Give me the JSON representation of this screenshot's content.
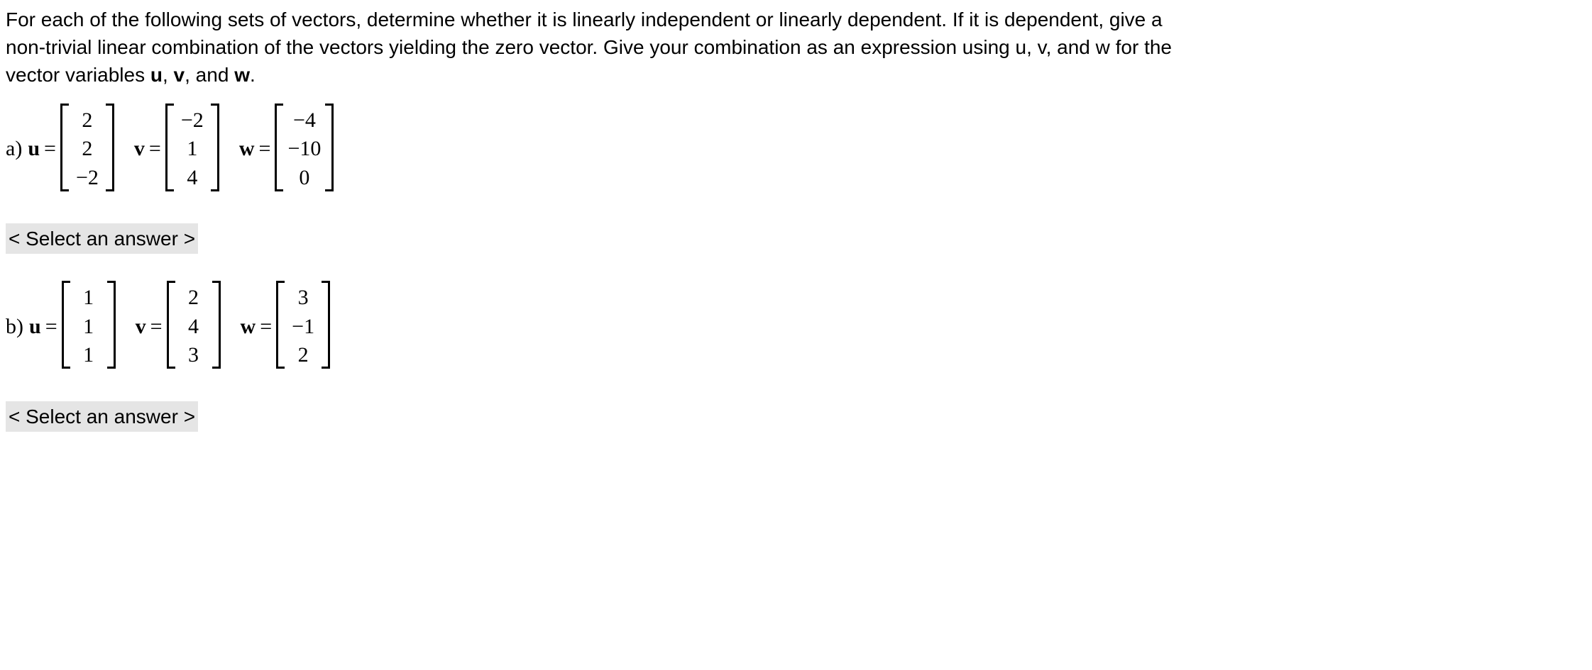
{
  "instructions": {
    "line1_part1": "For each of the following sets of vectors, determine whether it is linearly independent or linearly dependent. If it is dependent, give a",
    "line2_part1": "non-trivial linear combination of the vectors yielding the zero vector. Give your combination as an expression using u, v, and w for the",
    "line3_part1": "vector variables ",
    "line3_var_u": "u",
    "line3_comma1": ", ",
    "line3_var_v": "v",
    "line3_comma2": ", and ",
    "line3_var_w": "w",
    "line3_period": "."
  },
  "problems": {
    "a": {
      "label": "a) ",
      "u_sym": "u",
      "v_sym": "v",
      "w_sym": "w",
      "eq": " = ",
      "u": [
        "2",
        "2",
        "−2"
      ],
      "v": [
        "−2",
        "1",
        "4"
      ],
      "w": [
        "−4",
        "−10",
        "0"
      ],
      "select": "< Select an answer >"
    },
    "b": {
      "label": "b) ",
      "u_sym": "u",
      "v_sym": "v",
      "w_sym": "w",
      "eq": " = ",
      "u": [
        "1",
        "1",
        "1"
      ],
      "v": [
        "2",
        "4",
        "3"
      ],
      "w": [
        "3",
        "−1",
        "2"
      ],
      "select": "< Select an answer >"
    }
  }
}
